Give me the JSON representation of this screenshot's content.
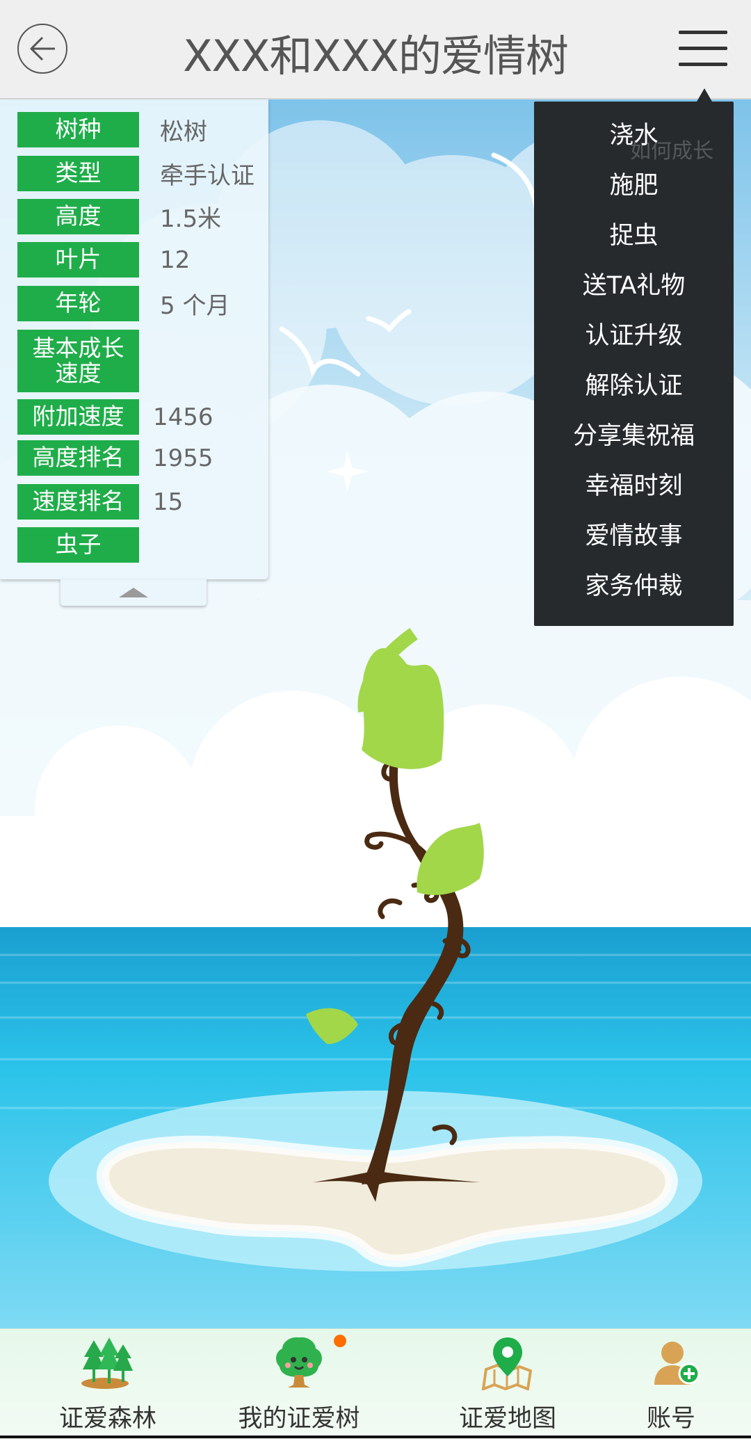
{
  "header": {
    "title": "XXX和XXX的爱情树",
    "back_icon": "arrow-left-icon",
    "menu_icon": "hamburger-icon"
  },
  "info": {
    "rows": [
      {
        "label": "树种",
        "value": "松树"
      },
      {
        "label": "类型",
        "value": "牵手认证"
      },
      {
        "label": "高度",
        "value": "1.5米"
      },
      {
        "label": "叶片",
        "value": "12"
      },
      {
        "label": "年轮",
        "value": "5 个月"
      },
      {
        "label": "基本成长速度",
        "value": ""
      },
      {
        "label": "附加速度",
        "value": "1456"
      },
      {
        "label": "高度排名",
        "value": "1955"
      },
      {
        "label": "速度排名",
        "value": "15"
      },
      {
        "label": "虫子",
        "value": ""
      }
    ]
  },
  "menu": {
    "ghost_label": "如何成长",
    "items": [
      "浇水",
      "施肥",
      "捉虫",
      "送TA礼物",
      "认证升级",
      "解除认证",
      "分享集祝福",
      "幸福时刻",
      "爱情故事",
      "家务仲裁"
    ]
  },
  "nav": {
    "items": [
      {
        "label": "证爱森林",
        "icon": "forest-icon"
      },
      {
        "label": "我的证爱树",
        "icon": "my-tree-icon"
      },
      {
        "label": "证爱地图",
        "icon": "map-pin-icon"
      },
      {
        "label": "账号",
        "icon": "account-icon"
      }
    ]
  },
  "colors": {
    "label_green": "#1fad4a",
    "menu_bg": "#262a2d",
    "notif": "#ff6d00",
    "leaf": "#a2d74a",
    "trunk": "#4a2a12"
  }
}
